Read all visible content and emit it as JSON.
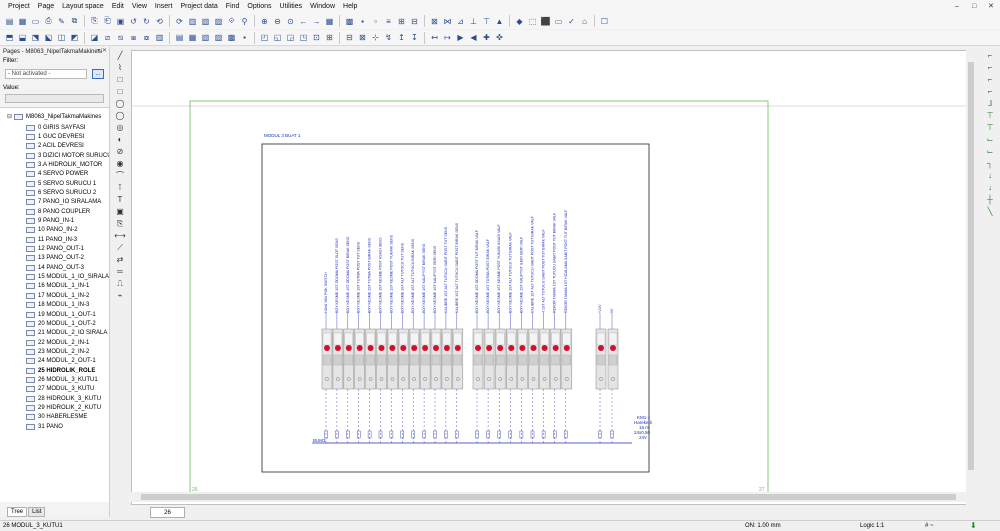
{
  "menu": [
    "Project",
    "Page",
    "Layout space",
    "Edit",
    "View",
    "Insert",
    "Project data",
    "Find",
    "Options",
    "Utilities",
    "Window",
    "Help"
  ],
  "window_controls": {
    "minimize": "–",
    "maximize": "□",
    "close": "✕"
  },
  "panel": {
    "title": "Pages - M8063_NipelTakmaMakinesi",
    "pin": "▾ ✕",
    "filter_label": "Filter:",
    "filter_value": "- Not activated -",
    "filter_button": "...",
    "value_label": "Value:"
  },
  "tree": {
    "root": "M8063_NipelTakmaMakines",
    "items": [
      "0 GIRIS SAYFASI",
      "1 GUC DEVRESI",
      "2 ACIL DEVRESI",
      "3 DIZICI MOTOR SURUCU",
      "3.A HIDROLIK_MOTOR",
      "4 SERVO POWER",
      "5 SERVO SURUCU 1",
      "6 SERVO SURUCU 2",
      "7 PANO_IO SIRALAMA",
      "8 PANO COUPLER",
      "9 PANO_IN-1",
      "10 PANO_IN-2",
      "11 PANO_IN-3",
      "12 PANO_OUT-1",
      "13 PANO_OUT-2",
      "14 PANO_OUT-3",
      "15 MODUL_1_IO_SIRALA",
      "16 MODUL_1_IN-1",
      "17 MODUL_1_IN-2",
      "18 MODUL_1_IN-3",
      "19 MODUL_1_OUT-1",
      "20 MODUL_1_OUT-2",
      "21 MODUL_2_IO SIRALA",
      "22 MODUL_2_IN-1",
      "23 MODUL_2_IN-2",
      "24 MODUL_2_OUT-1",
      "25 HIDROLIK_ROLE",
      "26 MODUL_3_KUTU1",
      "27 MODUL_3_KUTU",
      "28 HIDROLIK_3_KUTU",
      "29 HIDROLIK_2_KUTU",
      "30 HABERLESME",
      "31 PANO"
    ],
    "selected_index": 27
  },
  "bottom_tabs": [
    "Tree",
    "List"
  ],
  "page_tab": "26",
  "drawing": {
    "frame_left_number": "26",
    "frame_right_number": "27",
    "title": "MODUL 3 BUAT 1",
    "signal_labels": [
      "HAVA YAN POK SWITCH",
      "BOY KESME 1ST ODOMA POST SLOT SENS",
      "BOY KESME 1ST ODOMA POST BIRAK SENS",
      "BOY KESME 1ST TUTMA POST TUT SENS",
      "BOY KESME 1ST TUTMA POST BIRAK SENS",
      "BOY KESME 1ST KESME POST ASAGI SENS",
      "BOY KESME 1ST KESME POST YUKARI SENS",
      "BOY KESME 1ST ALT TUTUCU TUT SENS",
      "BOY KESME 1ST ALT TUTUCU BIRAK SENS",
      "BOY KESME 1ST KALIPYST BIRAK SENS",
      "BOY KESME 1ST KALIPYST GERI SENS",
      "KALIBRE 1ST ALT TUTUCU SABIT POST TUT SENS",
      "KALIBRE 1ST ALT TUTUCU SABIT POST BIRAK SENS",
      "BOY KESME 1ST ODOMA POST TUT BIRAK VALF",
      "BOY KESME 1ST TUTMA POST BIRAK VALF",
      "BOY KESME 1ST KESME POST YUKARI ASAGI VALF",
      "BOY KESME 1ST ALT TUTUCU TUT BIRAK VALF",
      "BOY KESME 1ST KALIPYST ILERI GERI VALF",
      "KALIBRE 1ST ALT TUTUCU SABIT POST TUT BIRAK VALF",
      "4 1ST ALT TUTUCU SABIT POST TUT BIRAK VALF",
      "REKOR TAKMA 1ST TUTUCU SABIT POST TUT BIRAK VALF",
      "REKOR TAKMA 1ST HIZALAMA SABIT POST TUT BIRAK VALF",
      "+24V",
      "0V"
    ],
    "terminal_label": "BUM3",
    "device_tag": "KM1-1",
    "device_desc": "Hareketli",
    "device_len": "15 m",
    "device_section": "24x0,50",
    "device_volt": "24V"
  },
  "status": {
    "left": "26 MODUL_3_KUTU1",
    "on": "ON: 1.00 mm",
    "logic": "Logic 1:1",
    "hash": "# ~"
  },
  "colors": {
    "schematic_blue": "#1e2fb8",
    "led_red": "#d3102c",
    "frame_green": "#6abf5a"
  }
}
